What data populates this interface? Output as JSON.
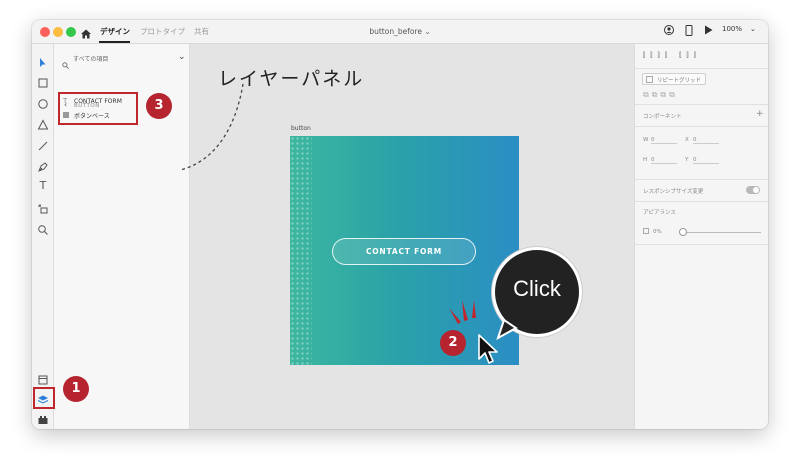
{
  "titlebar": {
    "tabs": [
      {
        "label": "デザイン",
        "active": true
      },
      {
        "label": "プロトタイプ",
        "active": false
      },
      {
        "label": "共有",
        "active": false
      }
    ],
    "document_title": "button_before ⌄",
    "zoom": "100%"
  },
  "layers_panel": {
    "search_placeholder": "すべての項目",
    "group_label": "BUTTON",
    "items": [
      {
        "label": "CONTACT FORM",
        "icon": "text-icon"
      },
      {
        "label": "ボタンベース",
        "icon": "rectangle-icon"
      }
    ]
  },
  "canvas": {
    "artboard_label": "button",
    "button_text": "CONTACT FORM"
  },
  "properties": {
    "repeat_grid_label": "リピートグリッド",
    "component_label": "コンポーネント",
    "w_label": "W",
    "w_value": "0",
    "h_label": "H",
    "h_value": "0",
    "x_label": "X",
    "x_value": "0",
    "y_label": "Y",
    "y_value": "0",
    "responsive_label": "レスポンシブサイズ変更",
    "appearance_label": "アピアランス",
    "opacity_value": "0%"
  },
  "annotations": {
    "panel_caption": "レイヤーパネル",
    "click_label": "Click",
    "badge_1": "1",
    "badge_2": "2",
    "badge_3": "3"
  },
  "colors": {
    "badge_red": "#b5242f",
    "gradient_start": "#3db79f",
    "gradient_end": "#2b8ec4"
  }
}
